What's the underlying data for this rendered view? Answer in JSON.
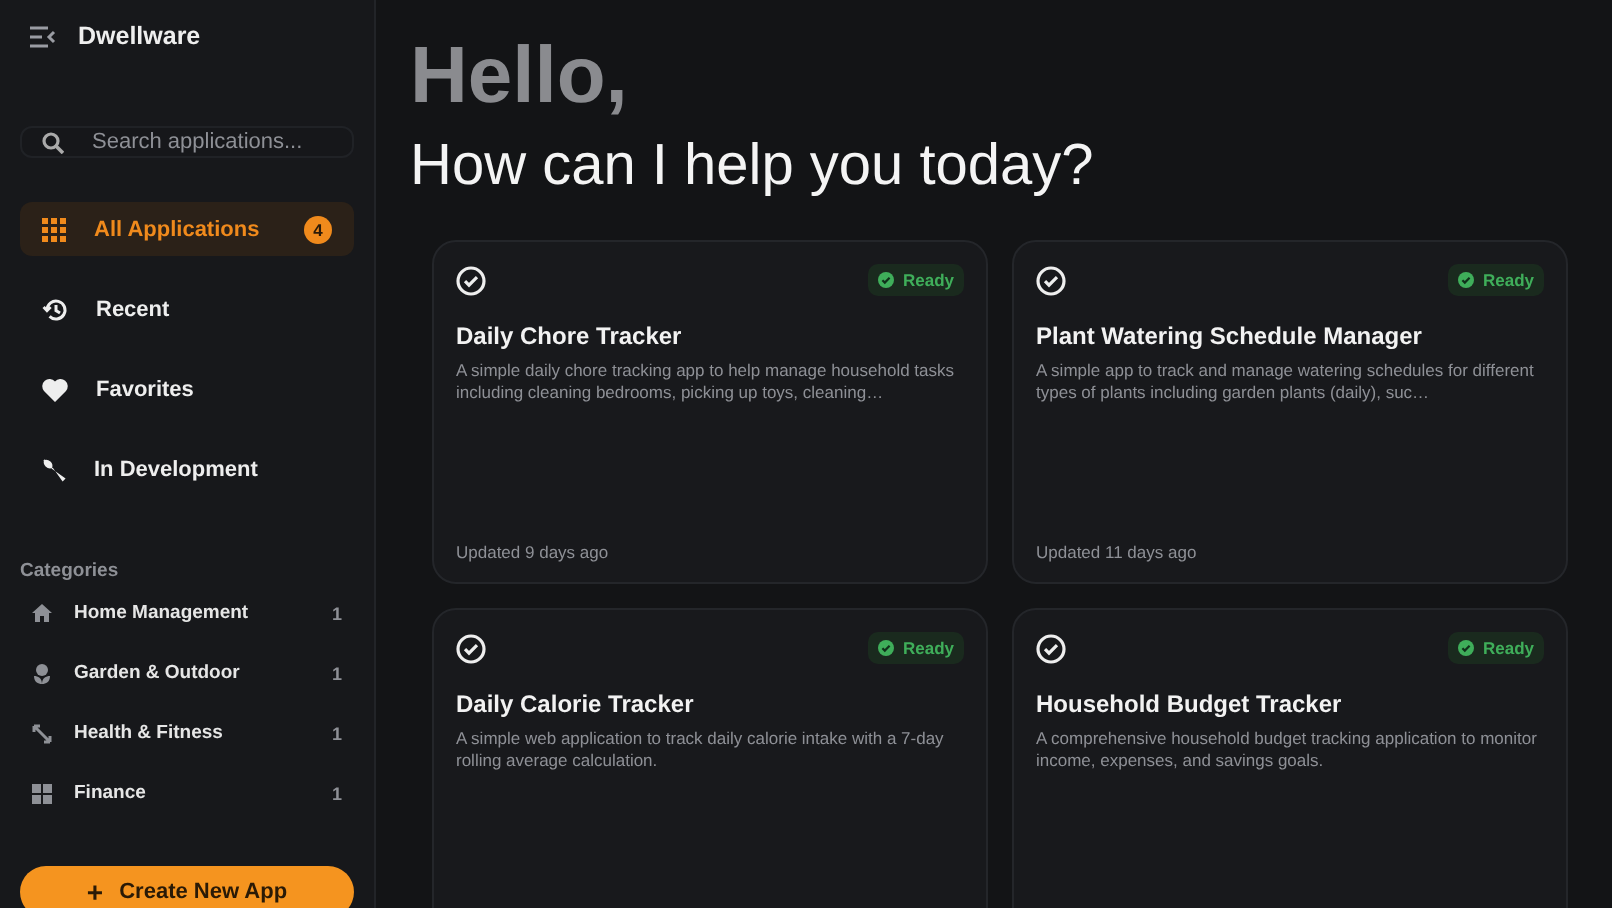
{
  "app": {
    "name": "Dwellware"
  },
  "search": {
    "placeholder": "Search applications..."
  },
  "nav": [
    {
      "label": "All Applications",
      "selected": true,
      "badge": "4"
    },
    {
      "label": "Recent",
      "selected": false
    },
    {
      "label": "Favorites",
      "selected": false
    },
    {
      "label": "In Development",
      "selected": false
    }
  ],
  "categories": {
    "title": "Categories",
    "items": [
      {
        "label": "Home Management",
        "count": "1"
      },
      {
        "label": "Garden & Outdoor",
        "count": "1"
      },
      {
        "label": "Health & Fitness",
        "count": "1"
      },
      {
        "label": "Finance",
        "count": "1"
      }
    ]
  },
  "create_button": "Create New App",
  "create_button_icon": "+",
  "greeting": "Hello,",
  "subtitle": "How can I help you today?",
  "cards": [
    {
      "title": "Daily Chore Tracker",
      "status": "Ready",
      "description": "A simple daily chore tracking app to help manage household tasks including cleaning bedrooms, picking up toys, cleaning…",
      "updated": "Updated 9 days ago"
    },
    {
      "title": "Plant Watering Schedule Manager",
      "status": "Ready",
      "description": "A simple app to track and manage watering schedules for different types of plants including garden plants (daily), suc…",
      "updated": "Updated 11 days ago"
    },
    {
      "title": "Daily Calorie Tracker",
      "status": "Ready",
      "description": "A simple web application to track daily calorie intake with a 7-day rolling average calculation."
    },
    {
      "title": "Household Budget Tracker",
      "status": "Ready",
      "description": "A comprehensive household budget tracking application to monitor income, expenses, and savings goals."
    }
  ]
}
